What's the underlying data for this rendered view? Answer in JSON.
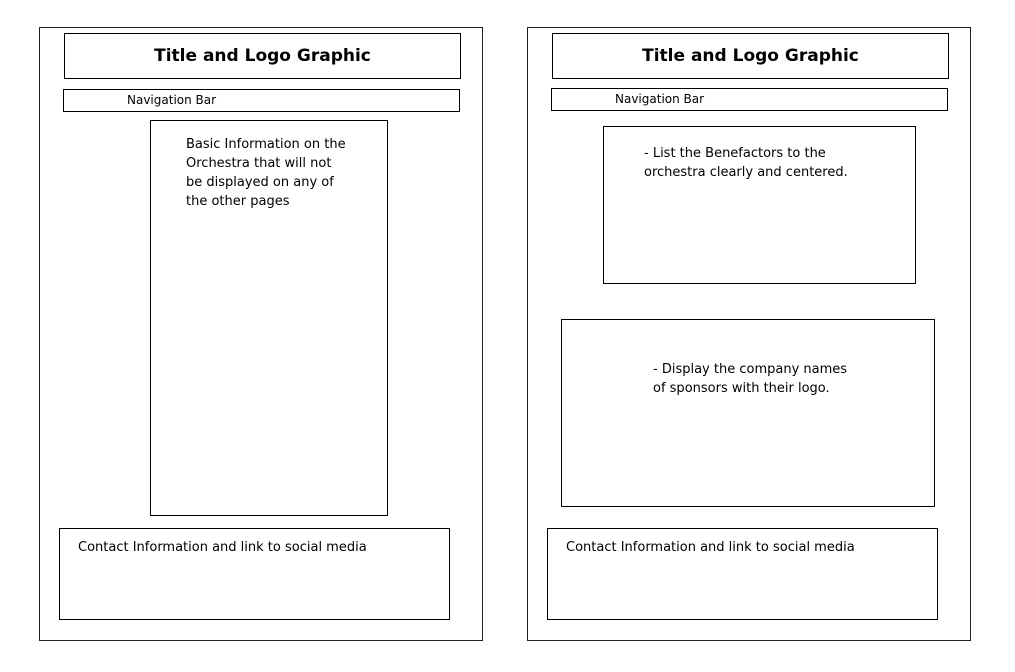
{
  "left_page": {
    "title": "Title and Logo Graphic",
    "nav_label": "Navigation Bar",
    "main_lines": [
      "Basic Information on the",
      "Orchestra that will not",
      "be displayed on any of",
      "the other pages"
    ],
    "footer_text": "Contact Information and link to social media"
  },
  "right_page": {
    "title": "Title and Logo Graphic",
    "nav_label": "Navigation Bar",
    "benefactors_lines": [
      "- List the Benefactors to the",
      "orchestra clearly and centered."
    ],
    "sponsors_lines": [
      "- Display the company names",
      "of sponsors with their logo."
    ],
    "footer_text": "Contact Information and link to social media"
  }
}
